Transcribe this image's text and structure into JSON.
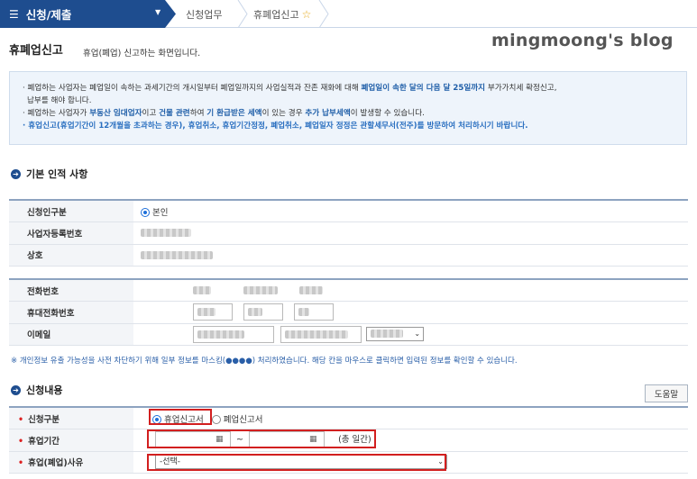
{
  "topbar": {
    "menu_label": "신청/제출",
    "crumbs": [
      "신청업무",
      "휴폐업신고"
    ]
  },
  "page": {
    "title": "휴폐업신고",
    "subtitle": "휴업(폐업) 신고하는 화면입니다.",
    "watermark": "mingmoong's blog"
  },
  "notice": {
    "line1_a": "· 폐업하는 사업자는 폐업일이 속하는 과세기간의 개시일부터 폐업일까지의 사업실적과 잔존 재화에 대해 ",
    "line1_b": "폐업일이 속한 달의 다음 달 25일까지",
    "line1_c": " 부가가치세 확정신고,",
    "line2": "납부를 해야 합니다.",
    "line3_a": "· 폐업하는 사업자가 ",
    "line3_b": "부동산 임대업자",
    "line3_c": "이고 ",
    "line3_d": "건물 관련",
    "line3_e": "하여 ",
    "line3_f": "기 환급받은 세액",
    "line3_g": "이 있는 경우 ",
    "line3_h": "추가 납부세액",
    "line3_i": "이 발생할 수 있습니다.",
    "line4": "· 휴업신고(휴업기간이 12개월을 초과하는 경우), 휴업취소, 휴업기간정정, 폐업취소, 폐업일자 정정은 관할세무서(전주)를 방문하여 처리하시기 바랍니다."
  },
  "basic_section": {
    "title": "기본 인적 사항",
    "rows": [
      {
        "label": "신청인구분",
        "value": "본인"
      },
      {
        "label": "사업자등록번호"
      },
      {
        "label": "상호"
      }
    ],
    "contact_rows": [
      {
        "label": "전화번호"
      },
      {
        "label": "휴대전화번호"
      },
      {
        "label": "이메일"
      }
    ]
  },
  "mask_note": "※ 개인정보 유출 가능성을 사전 차단하기 위해 일부 정보를 마스킹(●●●●) 처리하였습니다. 해당 칸을 마우스로 클릭하면 입력된 정보를 확인할 수 있습니다.",
  "apply_section": {
    "title": "신청내용",
    "help_label": "도움말",
    "type_label": "신청구분",
    "type_opt1": "휴업신고서",
    "type_opt2": "폐업신고서",
    "period_label": "휴업기간",
    "period_tilde": "~",
    "period_total": "(총    일간)",
    "reason_label": "휴업(폐업)사유",
    "reason_selected": "-선택-"
  },
  "colors": {
    "nav_blue": "#1e4d8f",
    "highlight_red": "#d21f1f",
    "notice_bg": "#eef4fb"
  }
}
